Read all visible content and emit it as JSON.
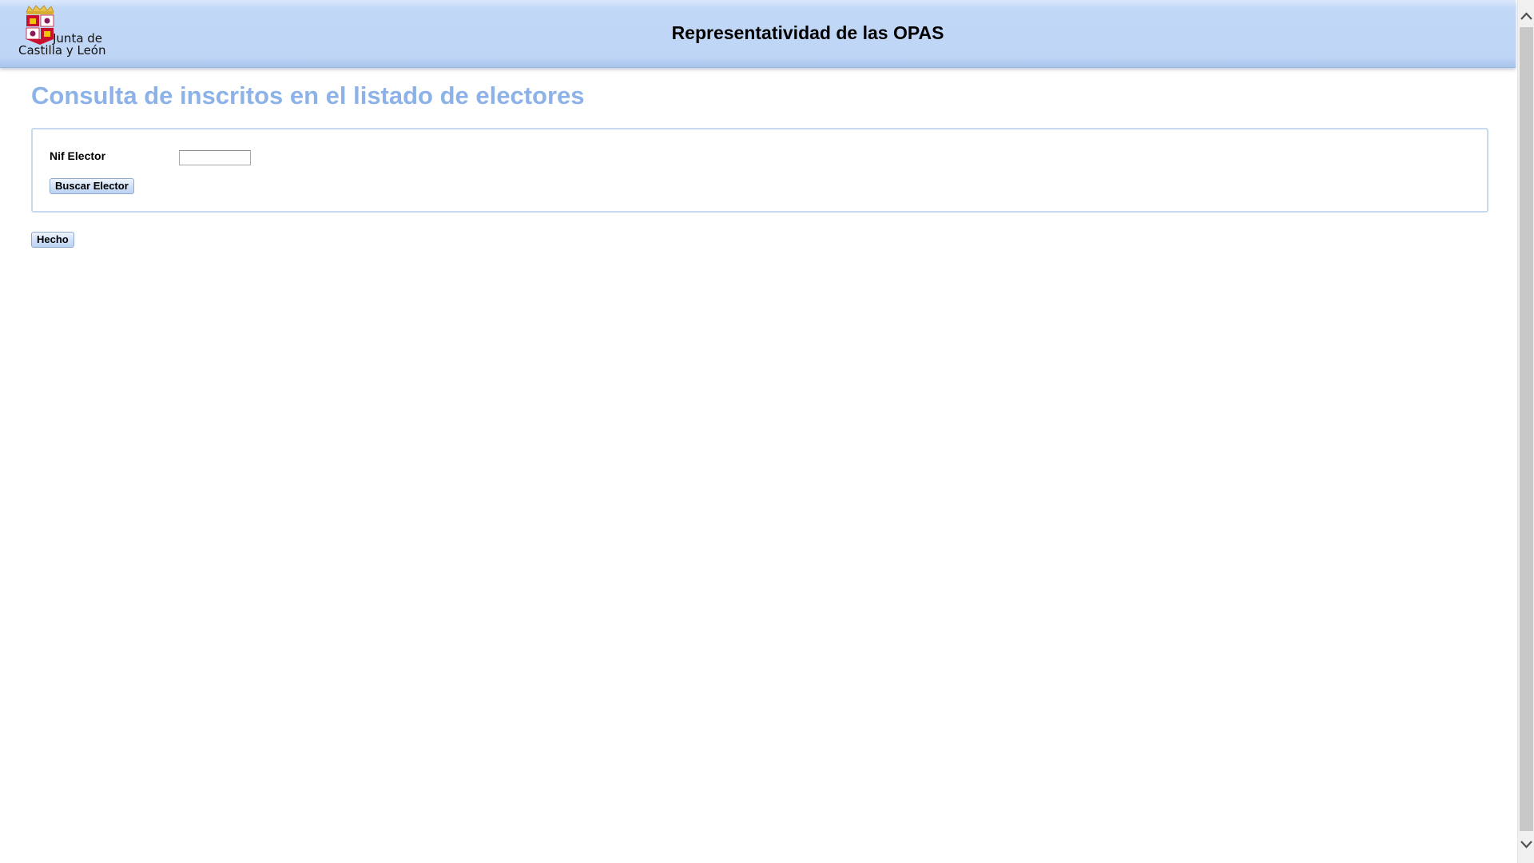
{
  "header": {
    "logo_line1": "Junta de",
    "logo_line2": "Castilla y León",
    "app_title": "Representatividad de las OPAS"
  },
  "page": {
    "title": "Consulta de inscritos en el listado de electores"
  },
  "form": {
    "nif_label": "Nif Elector",
    "nif_value": "",
    "nif_placeholder": "",
    "search_button": "Buscar Elector"
  },
  "actions": {
    "done_button": "Hecho"
  },
  "icons": {
    "logo": "castilla-y-leon-coat-of-arms-icon",
    "scroll_up": "chevron-up-icon",
    "scroll_down": "chevron-down-icon"
  },
  "colors": {
    "header_bg": "#bfd5f6",
    "title_color": "#8cb2e8",
    "panel_border": "#c8d9ef",
    "button_bg": "#d2e2f8"
  }
}
